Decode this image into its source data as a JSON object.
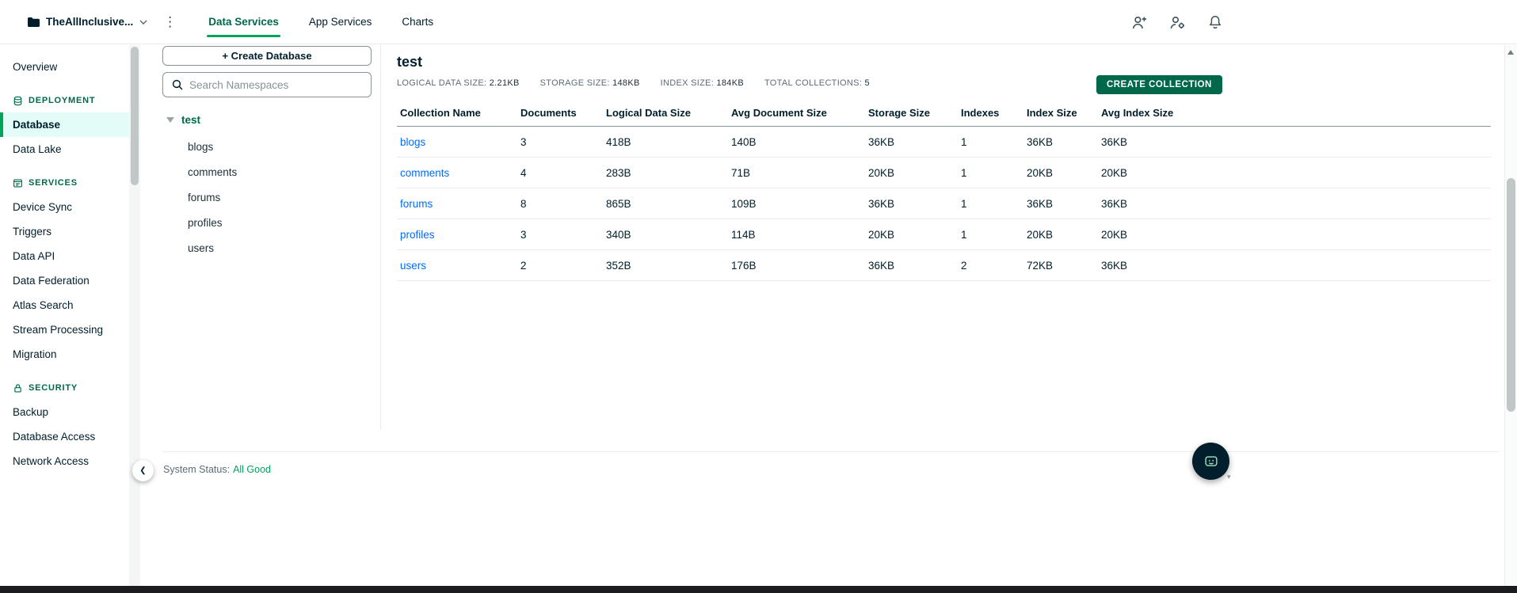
{
  "colors": {
    "primary_green": "#00684A",
    "accent_green": "#00A35C",
    "active_item_bg": "#E3FCF7",
    "link_blue": "#016BF8",
    "dark_text": "#001E2B",
    "gray_text": "#5C6C75"
  },
  "topnav": {
    "org_name": "TheAllInclusive...",
    "org_icon": "folder-icon",
    "tabs": [
      {
        "label": "Data Services",
        "active": true
      },
      {
        "label": "App Services",
        "active": false
      },
      {
        "label": "Charts",
        "active": false
      }
    ],
    "icons": [
      "invite-user-icon",
      "user-settings-icon",
      "bell-icon"
    ]
  },
  "sidebar": {
    "items": [
      {
        "type": "link",
        "label": "Overview",
        "active": false
      },
      {
        "type": "header",
        "label": "DEPLOYMENT",
        "icon": "deployment-icon"
      },
      {
        "type": "link",
        "label": "Database",
        "active": true
      },
      {
        "type": "link",
        "label": "Data Lake",
        "active": false
      },
      {
        "type": "header",
        "label": "SERVICES",
        "icon": "services-icon"
      },
      {
        "type": "link",
        "label": "Device Sync",
        "active": false
      },
      {
        "type": "link",
        "label": "Triggers",
        "active": false
      },
      {
        "type": "link",
        "label": "Data API",
        "active": false
      },
      {
        "type": "link",
        "label": "Data Federation",
        "active": false
      },
      {
        "type": "link",
        "label": "Atlas Search",
        "active": false
      },
      {
        "type": "link",
        "label": "Stream Processing",
        "active": false
      },
      {
        "type": "link",
        "label": "Migration",
        "active": false
      },
      {
        "type": "header",
        "label": "SECURITY",
        "icon": "security-icon"
      },
      {
        "type": "link",
        "label": "Backup",
        "active": false
      },
      {
        "type": "link",
        "label": "Database Access",
        "active": false
      },
      {
        "type": "link",
        "label": "Network Access",
        "active": false
      }
    ]
  },
  "namespaces": {
    "create_database_label": "+ Create Database",
    "search_placeholder": "Search Namespaces",
    "database": "test",
    "collections": [
      "blogs",
      "comments",
      "forums",
      "profiles",
      "users"
    ]
  },
  "main": {
    "title": "test",
    "stats": [
      {
        "label": "LOGICAL DATA SIZE:",
        "value": "2.21KB"
      },
      {
        "label": "STORAGE SIZE:",
        "value": "148KB"
      },
      {
        "label": "INDEX SIZE:",
        "value": "184KB"
      },
      {
        "label": "TOTAL COLLECTIONS:",
        "value": "5"
      }
    ],
    "create_collection_label": "CREATE COLLECTION",
    "table": {
      "headers": [
        "Collection Name",
        "Documents",
        "Logical Data Size",
        "Avg Document Size",
        "Storage Size",
        "Indexes",
        "Index Size",
        "Avg Index Size"
      ],
      "rows": [
        [
          "blogs",
          "3",
          "418B",
          "140B",
          "36KB",
          "1",
          "36KB",
          "36KB"
        ],
        [
          "comments",
          "4",
          "283B",
          "71B",
          "20KB",
          "1",
          "20KB",
          "20KB"
        ],
        [
          "forums",
          "8",
          "865B",
          "109B",
          "36KB",
          "1",
          "36KB",
          "36KB"
        ],
        [
          "profiles",
          "3",
          "340B",
          "114B",
          "20KB",
          "1",
          "20KB",
          "20KB"
        ],
        [
          "users",
          "2",
          "352B",
          "176B",
          "36KB",
          "2",
          "72KB",
          "36KB"
        ]
      ]
    }
  },
  "footer": {
    "status_label": "System Status:",
    "status_value": "All Good"
  }
}
